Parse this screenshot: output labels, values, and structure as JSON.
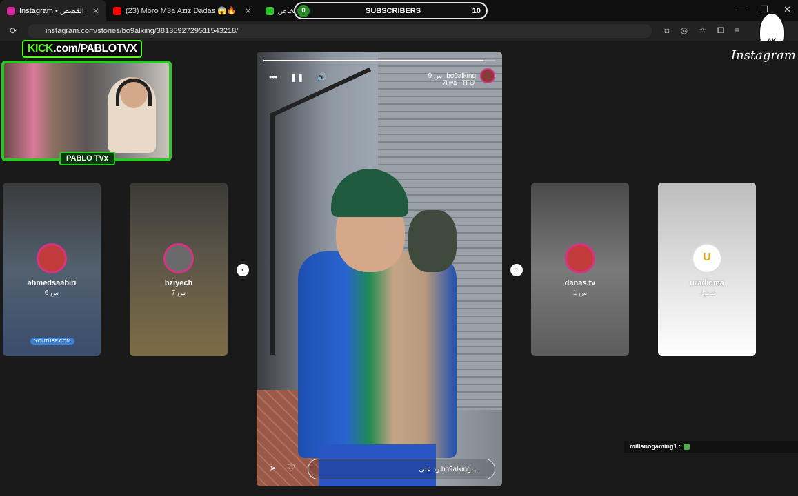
{
  "browser": {
    "tabs": [
      {
        "title": "Instagram • القصص",
        "color": "#d6249f",
        "active": true
      },
      {
        "title": "(23) Moro M3a Aziz Dadas 😱🔥",
        "color": "#ff0000",
        "active": false
      },
      {
        "title": "فيديو مع أشخاص",
        "color": "#2ec52a",
        "active": false
      }
    ],
    "url": "instagram.com/stories/bo9alking/3813592729511543218/",
    "window_controls": [
      "—",
      "❐",
      "✕"
    ]
  },
  "overlay": {
    "subscribers_count": "0",
    "subscribers_label": "SUBSCRIBERS",
    "subscribers_goal": "10",
    "kick_brand": "KICK",
    "kick_suffix": ".com/PABLOTVX",
    "streamer_name": "PABLO TVx",
    "badge_text": "AK",
    "chat_user": "millanogaming1 :"
  },
  "instagram": {
    "logo": "Instagram",
    "left_cards": [
      {
        "username": "ahmedsaabiri",
        "time": "6 س",
        "chip": "YOUTUBE.COM"
      },
      {
        "username": "hziyech",
        "time": "7 س"
      }
    ],
    "right_cards": [
      {
        "username": "danas.tv",
        "time": "1 س"
      },
      {
        "username": "uradioma",
        "time": "مُموّل"
      }
    ],
    "story": {
      "username": "bo9alking",
      "time": "9 س",
      "song": "7liwa · TFO",
      "reply_placeholder": "رد على bo9alking...",
      "progress": 0.95,
      "controls": [
        "•••",
        "❚❚",
        "🔊"
      ]
    },
    "nav": {
      "prev": "‹",
      "next": "›"
    }
  }
}
